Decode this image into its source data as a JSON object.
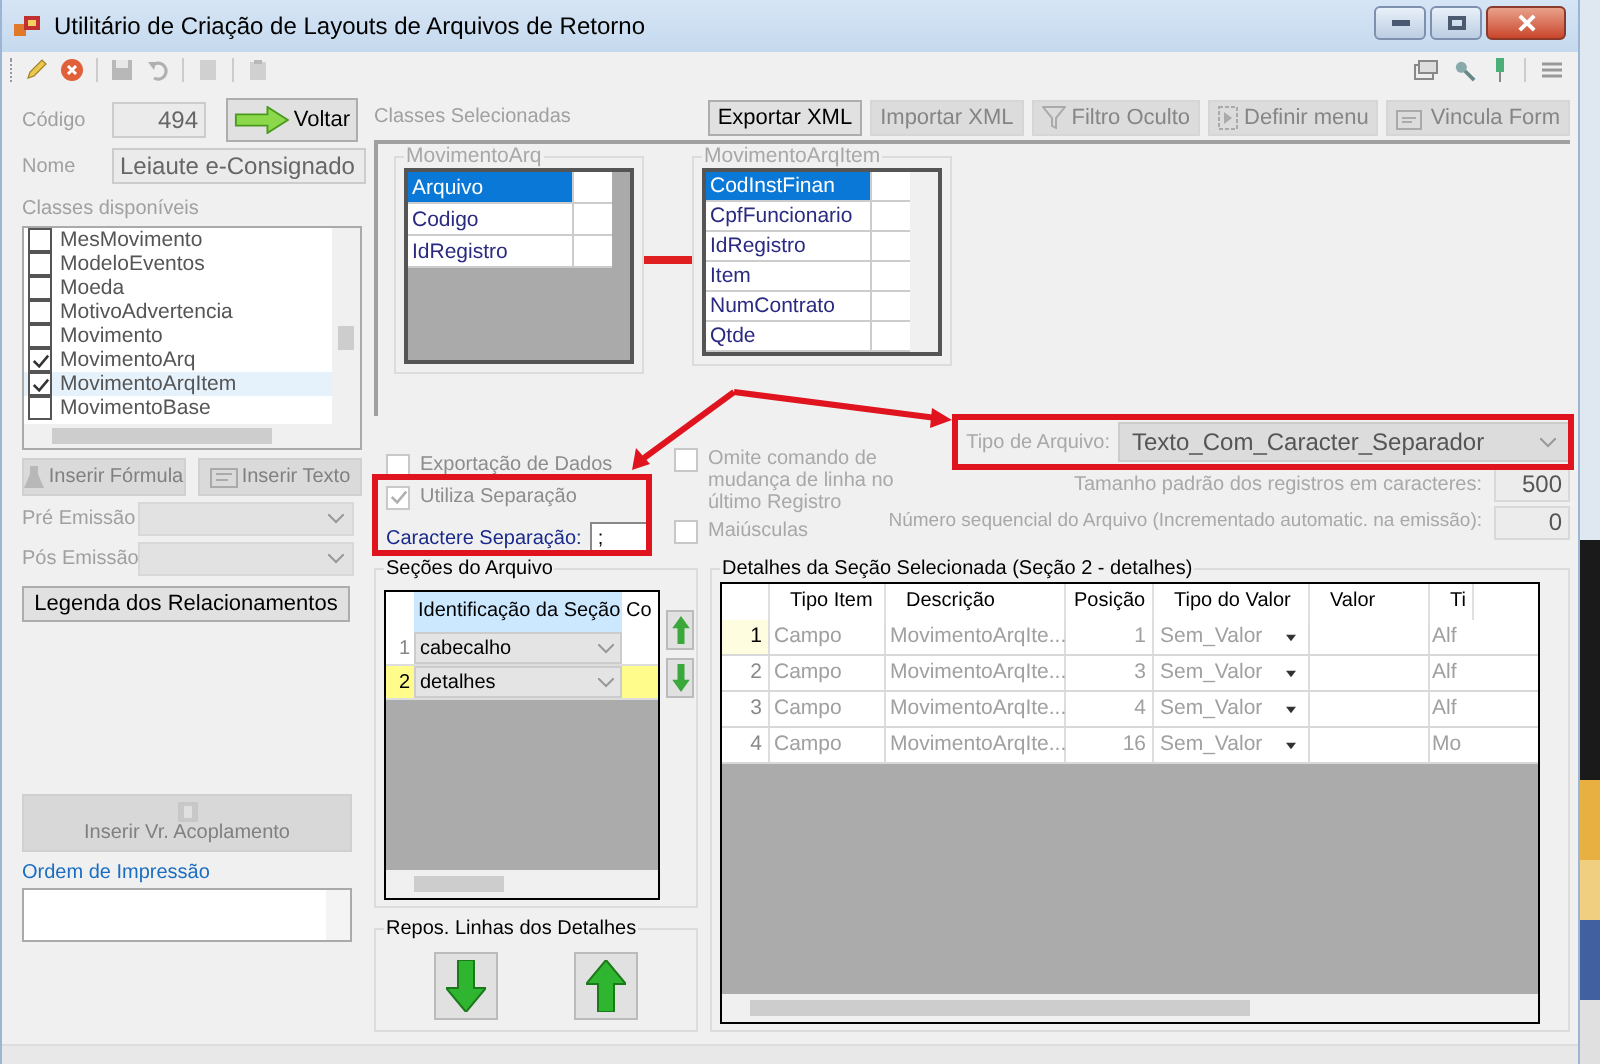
{
  "window": {
    "title": "Utilitário de Criação de Layouts de Arquivos de Retorno"
  },
  "codigo": {
    "label": "Código",
    "value": "494"
  },
  "voltar_button": {
    "label": "Voltar"
  },
  "nome": {
    "label": "Nome",
    "value": "Leiaute e-Consignado"
  },
  "classes_disponiveis": {
    "label": "Classes disponíveis",
    "items": [
      {
        "label": "MesMovimento",
        "checked": false,
        "selected": false
      },
      {
        "label": "ModeloEventos",
        "checked": false,
        "selected": false
      },
      {
        "label": "Moeda",
        "checked": false,
        "selected": false
      },
      {
        "label": "MotivoAdvertencia",
        "checked": false,
        "selected": false
      },
      {
        "label": "Movimento",
        "checked": false,
        "selected": false
      },
      {
        "label": "MovimentoArq",
        "checked": true,
        "selected": false
      },
      {
        "label": "MovimentoArqItem",
        "checked": true,
        "selected": true
      },
      {
        "label": "MovimentoBase",
        "checked": false,
        "selected": false
      }
    ]
  },
  "insert_buttons": [
    {
      "label": "Inserir Fórmula",
      "kind": "formula",
      "disabled": true
    },
    {
      "label": "Inserir Texto",
      "kind": "text",
      "disabled": true
    }
  ],
  "emissao_fields": [
    {
      "label": "Pré Emissão",
      "disabled": true
    },
    {
      "label": "Pós Emissão",
      "disabled": true
    }
  ],
  "legenda_button": {
    "label": "Legenda dos Relacionamentos"
  },
  "acoplamento_button": {
    "label": "Inserir Vr. Acoplamento",
    "disabled": true
  },
  "ordem_impressao": {
    "label": "Ordem de Impressão"
  },
  "classes_selecionadas": {
    "label": "Classes Selecionadas",
    "toolbar": [
      {
        "label": "Exportar XML",
        "kind": "plain",
        "disabled": false
      },
      {
        "label": "Importar XML",
        "kind": "plain",
        "disabled": true
      },
      {
        "label": "Filtro Oculto",
        "kind": "filter",
        "disabled": true
      },
      {
        "label": "Definir menu",
        "kind": "menu",
        "disabled": true
      },
      {
        "label": "Vincula Form",
        "kind": "form",
        "disabled": true
      }
    ],
    "tables": [
      {
        "title": "MovimentoArq",
        "fields": [
          {
            "name": "Arquivo",
            "selected": true
          },
          {
            "name": "Codigo",
            "selected": false
          },
          {
            "name": "IdRegistro",
            "selected": false
          }
        ]
      },
      {
        "title": "MovimentoArqItem",
        "fields": [
          {
            "name": "CodInstFinan",
            "selected": true
          },
          {
            "name": "CpfFuncionario",
            "selected": false
          },
          {
            "name": "IdRegistro",
            "selected": false
          },
          {
            "name": "Item",
            "selected": false
          },
          {
            "name": "NumContrato",
            "selected": false
          },
          {
            "name": "Qtde",
            "selected": false
          }
        ]
      }
    ]
  },
  "options": {
    "checkboxes": [
      {
        "label": "Exportação de Dados",
        "checked": false,
        "disabled": true
      },
      {
        "label": "Utiliza Separação",
        "checked": true,
        "disabled": true
      }
    ],
    "caractere_separacao": {
      "label": "Caractere Separação:",
      "value": ";"
    },
    "extra_checkboxes": [
      {
        "label": "Omite comando de mudança de linha no último Registro",
        "checked": false,
        "disabled": true
      },
      {
        "label": "Maiúsculas",
        "checked": false,
        "disabled": true
      }
    ],
    "tipo_arquivo": {
      "label": "Tipo de Arquivo:",
      "value": "Texto_Com_Caracter_Separador"
    },
    "tamanho": {
      "label": "Tamanho padrão dos registros em caracteres:",
      "value": "500"
    },
    "sequencial": {
      "label": "Número sequencial do Arquivo (Incrementado automatic. na emissão):",
      "value": "0"
    }
  },
  "secoes": {
    "title": "Seções do Arquivo",
    "columns": [
      "Identificação da Seção",
      "Co"
    ],
    "rows": [
      {
        "number": "1",
        "name": "cabecalho",
        "selected": false
      },
      {
        "number": "2",
        "name": "detalhes",
        "selected": true
      }
    ]
  },
  "repos": {
    "title": "Repos. Linhas dos Detalhes"
  },
  "detalhes": {
    "title": "Detalhes da Seção Selecionada (Seção 2 - detalhes)",
    "columns": [
      "Tipo Item",
      "Descrição",
      "Posição",
      "Tipo do Valor",
      "Valor",
      "Ti"
    ],
    "rows": [
      {
        "number": "1",
        "tipo_item": "Campo",
        "descricao": "MovimentoArqIte...",
        "posicao": "1",
        "tipo_valor": "Sem_Valor",
        "column_7": "Alf",
        "selected": true
      },
      {
        "number": "2",
        "tipo_item": "Campo",
        "descricao": "MovimentoArqIte...",
        "posicao": "3",
        "tipo_valor": "Sem_Valor",
        "column_7": "Alf",
        "selected": false
      },
      {
        "number": "3",
        "tipo_item": "Campo",
        "descricao": "MovimentoArqIte...",
        "posicao": "4",
        "tipo_valor": "Sem_Valor",
        "column_7": "Alf",
        "selected": false
      },
      {
        "number": "4",
        "tipo_item": "Campo",
        "descricao": "MovimentoArqIte...",
        "posicao": "16",
        "tipo_valor": "Sem_Valor",
        "column_7": "Mo",
        "selected": false
      }
    ]
  }
}
